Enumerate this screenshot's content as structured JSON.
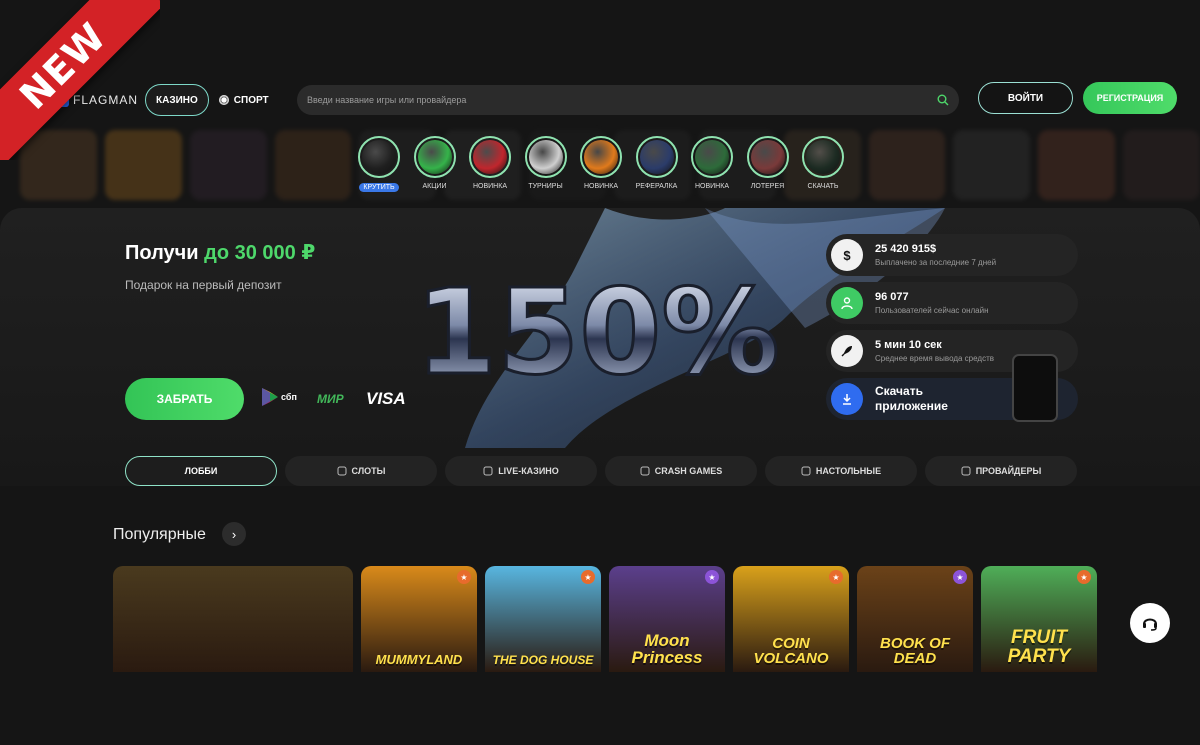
{
  "ribbon": {
    "label": "NEW"
  },
  "header": {
    "logo_text": "FLAGMAN",
    "logo_mark": "F",
    "nav": [
      {
        "label": "КАЗИНО",
        "active": true
      },
      {
        "label": "СПОРТ",
        "active": false
      }
    ],
    "search_placeholder": "Введи название игры или провайдера",
    "login_label": "ВОЙТИ",
    "register_label": "РЕГИСТРАЦИЯ"
  },
  "stories": [
    {
      "label": "КРУТИТЬ",
      "color": "#1f1f1f"
    },
    {
      "label": "АКЦИИ",
      "color": "#35b34a"
    },
    {
      "label": "НОВИНКА",
      "color": "#c0262d"
    },
    {
      "label": "ТУРНИРЫ",
      "color": "#cfcfcf"
    },
    {
      "label": "НОВИНКА",
      "color": "#e07a1c"
    },
    {
      "label": "РЕФЕРАЛКА",
      "color": "#2b3c6a"
    },
    {
      "label": "НОВИНКА",
      "color": "#2d6b3a"
    },
    {
      "label": "ЛОТЕРЕЯ",
      "color": "#7a3a3a"
    },
    {
      "label": "СКАЧАТЬ",
      "color": "#1c2b22"
    }
  ],
  "hero": {
    "title_main": "Получи ",
    "title_accent": "до 30 000 ₽",
    "subtitle": "Подарок на первый депозит",
    "cta_label": "ЗАБРАТЬ",
    "big_text": "150%",
    "payments": {
      "sbp": "сбп",
      "mir": "МИР",
      "visa": "VISA"
    }
  },
  "stats": [
    {
      "icon": "$",
      "value": "25 420 915$",
      "caption": "Выплачено за последние 7 дней"
    },
    {
      "icon": "user-icon",
      "value": "96 077",
      "caption": "Пользователей сейчас онлайн"
    },
    {
      "icon": "rocket-icon",
      "value": "5 мин 10 сек",
      "caption": "Среднее время вывода средств"
    },
    {
      "icon": "download-icon",
      "value_line1": "Скачать",
      "value_line2": "приложение"
    }
  ],
  "tabs": [
    {
      "label": "ЛОББИ",
      "active": true
    },
    {
      "label": "СЛОТЫ"
    },
    {
      "label": "LIVE-КАЗИНО"
    },
    {
      "label": "CRASH GAMES"
    },
    {
      "label": "НАСТОЛЬНЫЕ"
    },
    {
      "label": "ПРОВАЙДЕРЫ"
    }
  ],
  "popular": {
    "title": "Популярные",
    "arrow": "›",
    "games": [
      {
        "title": "",
        "bg": "#4a3a1e"
      },
      {
        "title": "MUMMYLAND",
        "bg": "#d98a1a"
      },
      {
        "title": "THE DOG HOUSE",
        "bg": "#58b6e0"
      },
      {
        "title": "Moon Princess",
        "bg": "#5b3f8c"
      },
      {
        "title": "COIN VOLCANO",
        "bg": "#d9a11b"
      },
      {
        "title": "BOOK OF DEAD",
        "bg": "#6b4218"
      },
      {
        "title": "FRUIT PARTY",
        "bg": "#4fae58"
      }
    ]
  },
  "colors": {
    "accent_green": "#4ed86b",
    "brand_blue": "#2f6cf0",
    "ribbon_red": "#d32226"
  }
}
